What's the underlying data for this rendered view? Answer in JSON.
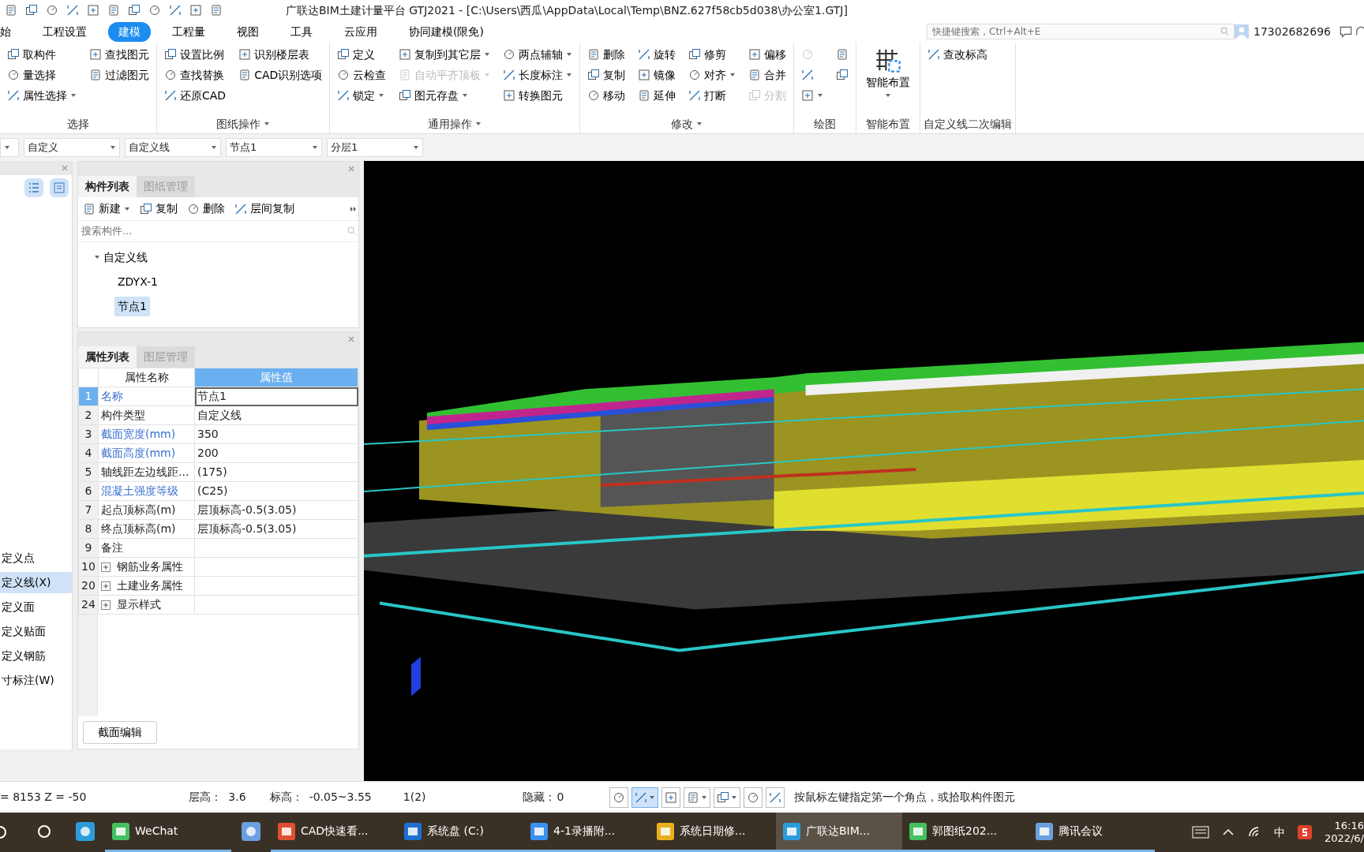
{
  "title_bar": {
    "title": "广联达BIM土建计量平台 GTJ2021 - [C:\\Users\\西瓜\\AppData\\Local\\Temp\\BNZ.627f58cb5d038\\办公室1.GTJ]"
  },
  "menu_tabs": [
    {
      "label": "始",
      "selected": false
    },
    {
      "label": "工程设置",
      "selected": false
    },
    {
      "label": "建模",
      "selected": true
    },
    {
      "label": "工程量",
      "selected": false
    },
    {
      "label": "视图",
      "selected": false
    },
    {
      "label": "工具",
      "selected": false
    },
    {
      "label": "云应用",
      "selected": false
    },
    {
      "label": "协同建模(限免)",
      "selected": false
    }
  ],
  "shortcut_search": {
    "placeholder": "快捷键搜索，Ctrl+Alt+E"
  },
  "user": {
    "name": "17302682696"
  },
  "ribbon_groups": [
    {
      "label": "选择",
      "menu": false,
      "columns": [
        [
          {
            "kind": "small",
            "label": "取构件",
            "dropdown": false,
            "disabled": false
          },
          {
            "kind": "small",
            "label": "量选择",
            "dropdown": false,
            "disabled": false
          },
          {
            "kind": "small",
            "label": "属性选择",
            "dropdown": true,
            "disabled": false
          }
        ],
        [
          {
            "kind": "small",
            "label": "查找图元",
            "dropdown": false,
            "disabled": false
          },
          {
            "kind": "small",
            "label": "过滤图元",
            "dropdown": false,
            "disabled": false
          }
        ]
      ]
    },
    {
      "label": "图纸操作",
      "menu": true,
      "columns": [
        [
          {
            "kind": "small",
            "label": "设置比例",
            "dropdown": false,
            "disabled": false
          },
          {
            "kind": "small",
            "label": "查找替换",
            "dropdown": false,
            "disabled": false
          },
          {
            "kind": "small",
            "label": "还原CAD",
            "dropdown": false,
            "disabled": false
          }
        ],
        [
          {
            "kind": "small",
            "label": "识别楼层表",
            "dropdown": false,
            "disabled": false
          },
          {
            "kind": "small",
            "label": "CAD识别选项",
            "dropdown": false,
            "disabled": false
          }
        ]
      ]
    },
    {
      "label": "通用操作",
      "menu": true,
      "columns": [
        [
          {
            "kind": "small",
            "label": "定义",
            "dropdown": false,
            "disabled": false
          },
          {
            "kind": "small",
            "label": "云检查",
            "dropdown": false,
            "disabled": false
          },
          {
            "kind": "small",
            "label": "锁定",
            "dropdown": true,
            "disabled": false
          }
        ],
        [
          {
            "kind": "small",
            "label": "复制到其它层",
            "dropdown": true,
            "disabled": false
          },
          {
            "kind": "small",
            "label": "自动平齐顶板",
            "dropdown": true,
            "disabled": true
          },
          {
            "kind": "small",
            "label": "图元存盘",
            "dropdown": true,
            "disabled": false
          }
        ],
        [
          {
            "kind": "small",
            "label": "两点辅轴",
            "dropdown": true,
            "disabled": false
          },
          {
            "kind": "small",
            "label": "长度标注",
            "dropdown": true,
            "disabled": false
          },
          {
            "kind": "small",
            "label": "转换图元",
            "dropdown": false,
            "disabled": false
          }
        ]
      ]
    },
    {
      "label": "修改",
      "menu": true,
      "columns": [
        [
          {
            "kind": "small",
            "label": "删除",
            "dropdown": false,
            "disabled": false
          },
          {
            "kind": "small",
            "label": "复制",
            "dropdown": false,
            "disabled": false
          },
          {
            "kind": "small",
            "label": "移动",
            "dropdown": false,
            "disabled": false
          }
        ],
        [
          {
            "kind": "small",
            "label": "旋转",
            "dropdown": false,
            "disabled": false
          },
          {
            "kind": "small",
            "label": "镜像",
            "dropdown": false,
            "disabled": false
          },
          {
            "kind": "small",
            "label": "延伸",
            "dropdown": false,
            "disabled": false
          }
        ],
        [
          {
            "kind": "small",
            "label": "修剪",
            "dropdown": false,
            "disabled": false
          },
          {
            "kind": "small",
            "label": "对齐",
            "dropdown": true,
            "disabled": false
          },
          {
            "kind": "small",
            "label": "打断",
            "dropdown": false,
            "disabled": false
          }
        ],
        [
          {
            "kind": "small",
            "label": "偏移",
            "dropdown": false,
            "disabled": false
          },
          {
            "kind": "small",
            "label": "合并",
            "dropdown": false,
            "disabled": false
          },
          {
            "kind": "small",
            "label": "分割",
            "dropdown": false,
            "disabled": true
          }
        ]
      ]
    },
    {
      "label": "绘图",
      "menu": false,
      "columns": [
        [
          {
            "kind": "icon",
            "dropdown": false,
            "disabled": true
          },
          {
            "kind": "icon",
            "dropdown": false,
            "disabled": false
          },
          {
            "kind": "icon",
            "dropdown": true,
            "disabled": false
          }
        ],
        [
          {
            "kind": "icon",
            "dropdown": false,
            "disabled": false
          },
          {
            "kind": "icon",
            "dropdown": false,
            "disabled": false
          }
        ]
      ]
    },
    {
      "label": "智能布置",
      "menu": false,
      "columns": [
        [
          {
            "kind": "large",
            "label": "智能布置",
            "dropdown": true,
            "disabled": false
          }
        ]
      ]
    },
    {
      "label": "自定义线二次编辑",
      "menu": false,
      "columns": [
        [
          {
            "kind": "small",
            "label": "查改标高",
            "dropdown": false,
            "disabled": false
          }
        ]
      ]
    }
  ],
  "selectors": [
    {
      "value": "自定义"
    },
    {
      "value": "自定义线"
    },
    {
      "value": "节点1"
    },
    {
      "value": "分层1"
    }
  ],
  "left_panel": {
    "items": [
      {
        "label": "定义点",
        "selected": false
      },
      {
        "label": "定义线(X)",
        "selected": true
      },
      {
        "label": "定义面",
        "selected": false
      },
      {
        "label": "定义贴面",
        "selected": false
      },
      {
        "label": "定义钢筋",
        "selected": false
      },
      {
        "label": "寸标注(W)",
        "selected": false
      }
    ]
  },
  "component_panel": {
    "tabs": [
      {
        "label": "构件列表",
        "selected": true
      },
      {
        "label": "图纸管理",
        "selected": false
      }
    ],
    "toolbar": [
      {
        "label": "新建",
        "dropdown": true
      },
      {
        "label": "复制",
        "dropdown": false
      },
      {
        "label": "删除",
        "dropdown": false
      },
      {
        "label": "层间复制",
        "dropdown": false
      }
    ],
    "search": {
      "placeholder": "搜索构件..."
    },
    "tree": [
      {
        "label": "自定义线",
        "expanded": true,
        "children": [
          {
            "label": "ZDYX-1",
            "selected": false
          },
          {
            "label": "节点1",
            "selected": true
          }
        ]
      }
    ]
  },
  "property_panel": {
    "tabs": [
      {
        "label": "属性列表",
        "selected": true
      },
      {
        "label": "图层管理",
        "selected": false
      }
    ],
    "columns": [
      {
        "label": "属性名称",
        "selected": false
      },
      {
        "label": "属性值",
        "selected": true
      }
    ],
    "rows": [
      {
        "number": "1",
        "name": "名称",
        "value": "节点1",
        "link": true,
        "expandable": false,
        "selected": true
      },
      {
        "number": "2",
        "name": "构件类型",
        "value": "自定义线",
        "link": false,
        "expandable": false,
        "selected": false
      },
      {
        "number": "3",
        "name": "截面宽度(mm)",
        "value": "350",
        "link": true,
        "expandable": false,
        "selected": false
      },
      {
        "number": "4",
        "name": "截面高度(mm)",
        "value": "200",
        "link": true,
        "expandable": false,
        "selected": false
      },
      {
        "number": "5",
        "name": "轴线距左边线距...",
        "value": "(175)",
        "link": false,
        "expandable": false,
        "selected": false
      },
      {
        "number": "6",
        "name": "混凝土强度等级",
        "value": "(C25)",
        "link": true,
        "expandable": false,
        "selected": false
      },
      {
        "number": "7",
        "name": "起点顶标高(m)",
        "value": "层顶标高-0.5(3.05)",
        "link": false,
        "expandable": false,
        "selected": false
      },
      {
        "number": "8",
        "name": "终点顶标高(m)",
        "value": "层顶标高-0.5(3.05)",
        "link": false,
        "expandable": false,
        "selected": false
      },
      {
        "number": "9",
        "name": "备注",
        "link": false,
        "expandable": false,
        "selected": false
      },
      {
        "number": "10",
        "name": "钢筋业务属性",
        "link": false,
        "expandable": true,
        "selected": false
      },
      {
        "number": "20",
        "name": "土建业务属性",
        "link": false,
        "expandable": true,
        "selected": false
      },
      {
        "number": "24",
        "name": "显示样式",
        "link": false,
        "expandable": true,
        "selected": false
      }
    ],
    "button": "截面编辑"
  },
  "status_bar": {
    "coordinates": "= 8153 Z = -50",
    "floor_height": {
      "label": "层高：",
      "value": "3.6"
    },
    "elevation": {
      "label": "标高：",
      "value": "-0.05~3.55"
    },
    "layer": "1(2)",
    "hidden": {
      "label": "隐藏：",
      "value": "0"
    },
    "tools": [
      {
        "dropdown": false,
        "selected": false
      },
      {
        "dropdown": true,
        "selected": true
      },
      {
        "dropdown": false,
        "selected": false
      },
      {
        "dropdown": true,
        "selected": false
      },
      {
        "dropdown": true,
        "selected": false
      },
      {
        "dropdown": false,
        "selected": false
      },
      {
        "dropdown": false,
        "selected": false
      }
    ],
    "hint": "按鼠标左键指定第一个角点，或拾取构件图元"
  },
  "taskbar": {
    "items": [
      {
        "kind": "search",
        "running": false,
        "active": false
      },
      {
        "kind": "icon",
        "running": false,
        "active": false
      },
      {
        "kind": "app",
        "label": "WeChat",
        "running": true,
        "active": false
      },
      {
        "kind": "icon",
        "running": false,
        "active": false
      },
      {
        "kind": "app",
        "label": "CAD快速看...",
        "running": true,
        "active": false
      },
      {
        "kind": "app",
        "label": "系统盘 (C:)",
        "running": true,
        "active": false
      },
      {
        "kind": "app",
        "label": "4-1录播附...",
        "running": true,
        "active": false
      },
      {
        "kind": "app",
        "label": "系统日期修...",
        "running": true,
        "active": false
      },
      {
        "kind": "app",
        "label": "广联达BIM...",
        "running": true,
        "active": true
      },
      {
        "kind": "app",
        "label": "郭图纸202...",
        "running": true,
        "active": false
      },
      {
        "kind": "app",
        "label": "腾讯会议",
        "running": true,
        "active": false
      }
    ],
    "input_method": "中",
    "time": "16:16",
    "date": "2022/6/"
  }
}
